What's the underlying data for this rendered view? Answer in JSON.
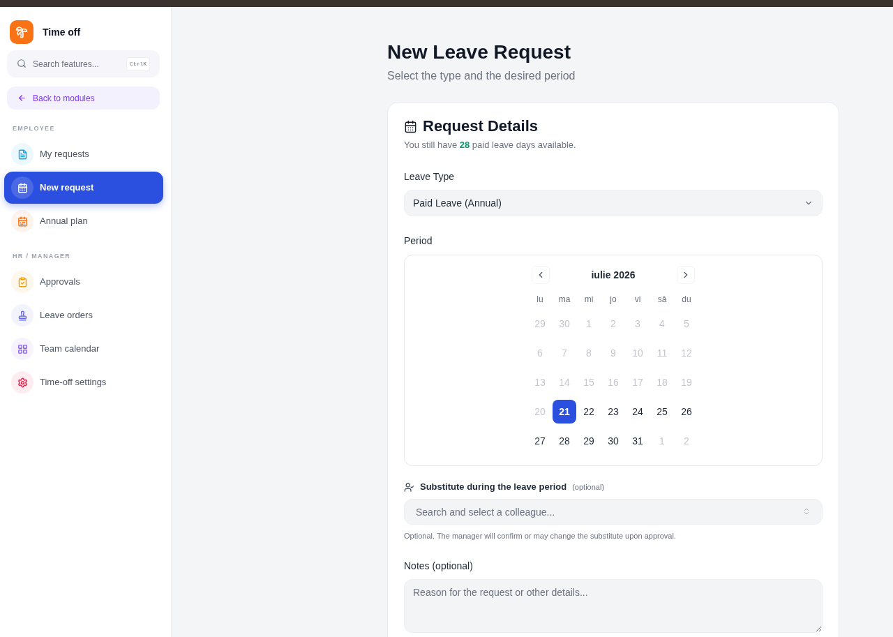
{
  "sidebar": {
    "app_title": "Time off",
    "search": {
      "placeholder": "Search features...",
      "shortcut": "CtrlK"
    },
    "back_link": "Back to modules",
    "sections": [
      {
        "title": "EMPLOYEE",
        "items": [
          {
            "label": "My requests",
            "selected": false,
            "color": "#0ea5e9"
          },
          {
            "label": "New request",
            "selected": true,
            "color": "#2b4fde"
          },
          {
            "label": "Annual plan",
            "selected": false,
            "color": "#f97316"
          }
        ]
      },
      {
        "title": "HR / MANAGER",
        "items": [
          {
            "label": "Approvals",
            "selected": false,
            "color": "#f59e0b"
          },
          {
            "label": "Leave orders",
            "selected": false,
            "color": "#6366f1"
          },
          {
            "label": "Team calendar",
            "selected": false,
            "color": "#8b5cf6"
          },
          {
            "label": "Time-off settings",
            "selected": false,
            "color": "#e11d48"
          }
        ]
      }
    ]
  },
  "page": {
    "title": "New Leave Request",
    "subtitle": "Select the type and the desired period"
  },
  "card": {
    "title": "Request Details",
    "balance_note": "You still have **28** paid leave days available.",
    "leave_type": {
      "label": "Leave Type",
      "value": "Paid Leave (Annual)"
    },
    "period": {
      "label": "Period",
      "calendar": {
        "month": "iulie 2026",
        "weekdays": [
          "lu",
          "ma",
          "mi",
          "jo",
          "vi",
          "sâ",
          "du"
        ],
        "weeks": [
          [
            {
              "day": "29",
              "disabled": true,
              "selected": false
            },
            {
              "day": "30",
              "disabled": true,
              "selected": false
            },
            {
              "day": "1",
              "disabled": true,
              "selected": false
            },
            {
              "day": "2",
              "disabled": true,
              "selected": false
            },
            {
              "day": "3",
              "disabled": true,
              "selected": false
            },
            {
              "day": "4",
              "disabled": true,
              "selected": false
            },
            {
              "day": "5",
              "disabled": true,
              "selected": false
            }
          ],
          [
            {
              "day": "6",
              "disabled": true,
              "selected": false
            },
            {
              "day": "7",
              "disabled": true,
              "selected": false
            },
            {
              "day": "8",
              "disabled": true,
              "selected": false
            },
            {
              "day": "9",
              "disabled": true,
              "selected": false
            },
            {
              "day": "10",
              "disabled": true,
              "selected": false
            },
            {
              "day": "11",
              "disabled": true,
              "selected": false
            },
            {
              "day": "12",
              "disabled": true,
              "selected": false
            }
          ],
          [
            {
              "day": "13",
              "disabled": true,
              "selected": false
            },
            {
              "day": "14",
              "disabled": true,
              "selected": false
            },
            {
              "day": "15",
              "disabled": true,
              "selected": false
            },
            {
              "day": "16",
              "disabled": true,
              "selected": false
            },
            {
              "day": "17",
              "disabled": true,
              "selected": false
            },
            {
              "day": "18",
              "disabled": true,
              "selected": false
            },
            {
              "day": "19",
              "disabled": true,
              "selected": false
            }
          ],
          [
            {
              "day": "20",
              "disabled": true,
              "selected": false
            },
            {
              "day": "21",
              "disabled": false,
              "selected": true
            },
            {
              "day": "22",
              "disabled": false,
              "selected": false
            },
            {
              "day": "23",
              "disabled": false,
              "selected": false
            },
            {
              "day": "24",
              "disabled": false,
              "selected": false
            },
            {
              "day": "25",
              "disabled": false,
              "selected": false
            },
            {
              "day": "26",
              "disabled": false,
              "selected": false
            }
          ],
          [
            {
              "day": "27",
              "disabled": false,
              "selected": false
            },
            {
              "day": "28",
              "disabled": false,
              "selected": false
            },
            {
              "day": "29",
              "disabled": false,
              "selected": false
            },
            {
              "day": "30",
              "disabled": false,
              "selected": false
            },
            {
              "day": "31",
              "disabled": false,
              "selected": false
            },
            {
              "day": "1",
              "disabled": true,
              "selected": false
            },
            {
              "day": "2",
              "disabled": true,
              "selected": false
            }
          ]
        ]
      }
    },
    "substitute": {
      "label": "Substitute during the leave period",
      "hint": "(optional)",
      "placeholder": "Search and select a colleague...",
      "help": "Optional. The manager will confirm or may change the substitute upon approval."
    },
    "notes": {
      "label": "Notes (optional)",
      "placeholder": "Reason for the request or other details..."
    }
  }
}
